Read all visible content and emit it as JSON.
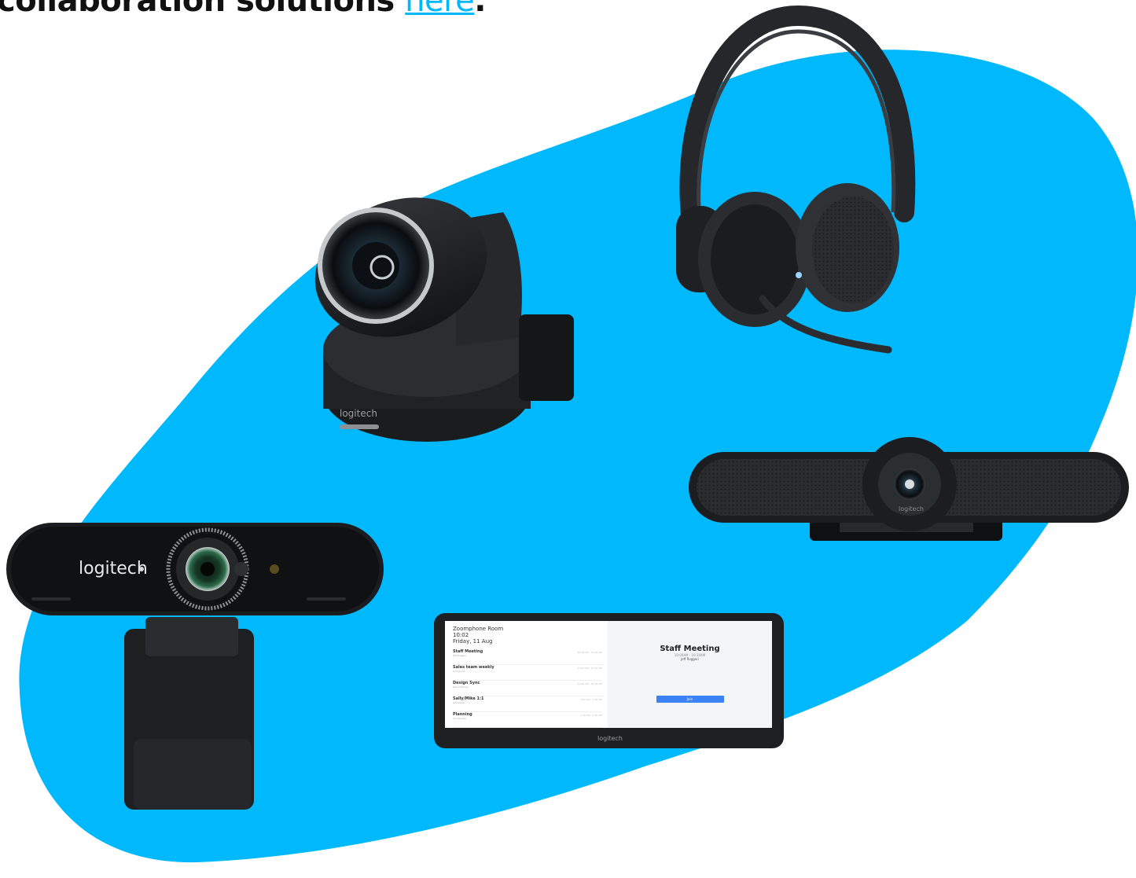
{
  "headline": {
    "text": "collaboration solutions ",
    "link_label": "here",
    "trailing": "."
  },
  "colors": {
    "blob": "#00b8fc",
    "link": "#00b8fc",
    "device_dark": "#1d1f21",
    "device_mid": "#2b2d30",
    "screen_bg": "#ffffff",
    "button_blue": "#3b82f6"
  },
  "products": {
    "webcam_brand": "logitech",
    "ptz_brand": "logitech",
    "bar_brand": "logitech",
    "tablet_brand": "logitech"
  },
  "tablet_screen": {
    "room_name": "Zoomphone Room",
    "time": "10:02",
    "date": "Friday, 11 Aug",
    "meetings": [
      {
        "title": "Staff Meeting",
        "sub": "Jeff Ruggeri",
        "time": "10:00 AM - 10:30 AM"
      },
      {
        "title": "Sales team weekly",
        "sub": "Kurt Jarvis",
        "time": "11:00 AM - 11:30 AM"
      },
      {
        "title": "Design Sync",
        "sub": "Dea Lattimer",
        "time": "12:00 AM - 12:30 AM"
      },
      {
        "title": "Sally/Mike 1:1",
        "sub": "Jen Grazik",
        "time": "1:00 AM - 1:30 AM"
      },
      {
        "title": "Planning",
        "sub": "Ana Mossle",
        "time": "1:30 AM - 2:30 AM"
      }
    ],
    "current_title": "Staff Meeting",
    "current_time": "10:00AM - 10:30AM",
    "current_host": "Jeff Ruggeri",
    "button_label": "Join"
  }
}
